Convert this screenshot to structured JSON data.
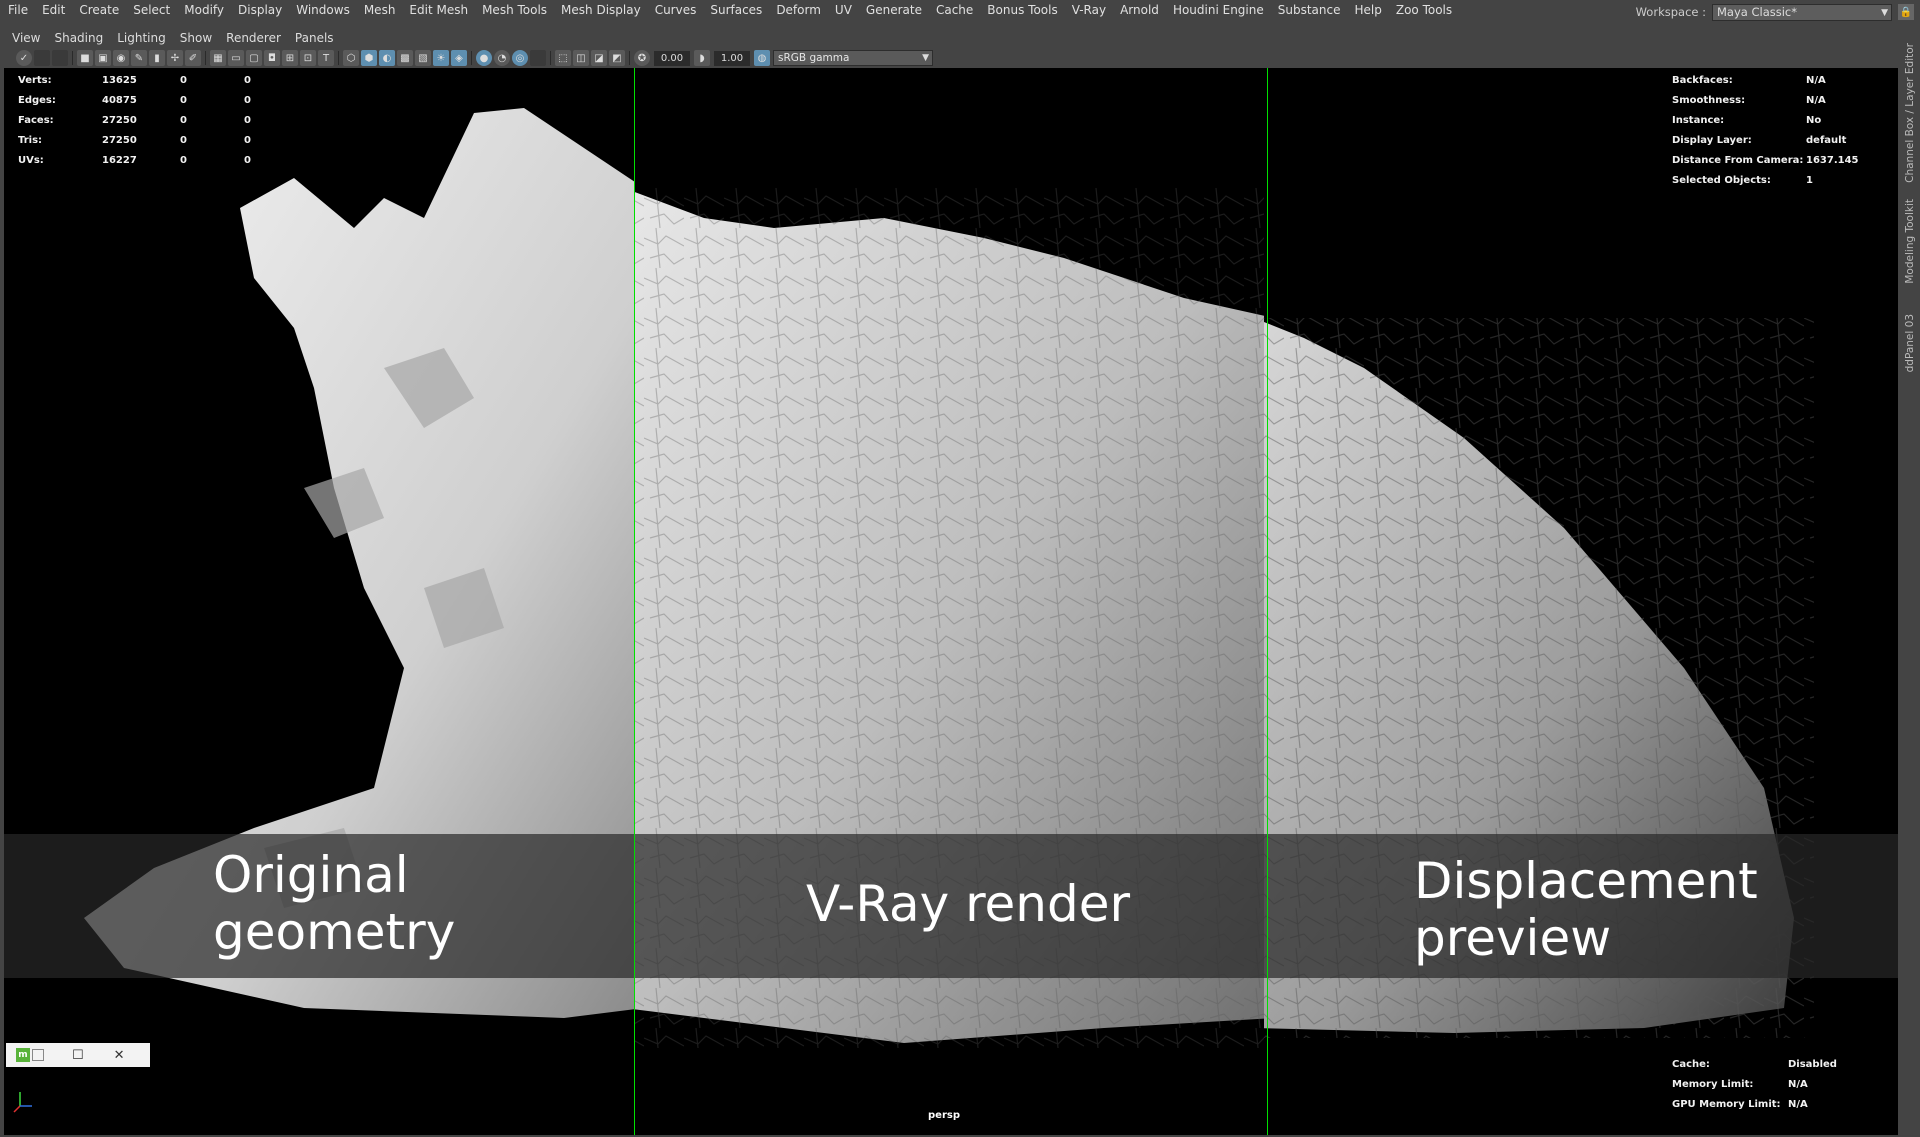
{
  "menubar": {
    "items": [
      "File",
      "Edit",
      "Create",
      "Select",
      "Modify",
      "Display",
      "Windows",
      "Mesh",
      "Edit Mesh",
      "Mesh Tools",
      "Mesh Display",
      "Curves",
      "Surfaces",
      "Deform",
      "UV",
      "Generate",
      "Cache",
      "Bonus Tools",
      "V-Ray",
      "Arnold",
      "Houdini Engine",
      "Substance",
      "Help",
      "Zoo Tools"
    ]
  },
  "workspace": {
    "label": "Workspace :",
    "value": "Maya Classic*"
  },
  "panel_menu": {
    "items": [
      "View",
      "Shading",
      "Lighting",
      "Show",
      "Renderer",
      "Panels"
    ]
  },
  "toolbar": {
    "exposure": "0.00",
    "gamma": "1.00",
    "color_space": "sRGB gamma"
  },
  "hud_left": {
    "rows": [
      {
        "label": "Verts:",
        "v1": "13625",
        "v2": "0",
        "v3": "0"
      },
      {
        "label": "Edges:",
        "v1": "40875",
        "v2": "0",
        "v3": "0"
      },
      {
        "label": "Faces:",
        "v1": "27250",
        "v2": "0",
        "v3": "0"
      },
      {
        "label": "Tris:",
        "v1": "27250",
        "v2": "0",
        "v3": "0"
      },
      {
        "label": "UVs:",
        "v1": "16227",
        "v2": "0",
        "v3": "0"
      }
    ]
  },
  "hud_right": {
    "rows": [
      {
        "label": "Backfaces:",
        "value": "N/A"
      },
      {
        "label": "Smoothness:",
        "value": "N/A"
      },
      {
        "label": "Instance:",
        "value": "No"
      },
      {
        "label": "Display Layer:",
        "value": "default"
      },
      {
        "label": "Distance From Camera:",
        "value": "1637.145"
      },
      {
        "label": "Selected Objects:",
        "value": "1"
      }
    ]
  },
  "hud_bottom": {
    "rows": [
      {
        "label": "Cache:",
        "value": "Disabled"
      },
      {
        "label": "Memory Limit:",
        "value": "N/A"
      },
      {
        "label": "GPU Memory Limit:",
        "value": "N/A"
      }
    ]
  },
  "captions": {
    "left_line1": "Original",
    "left_line2": "geometry",
    "middle": "V-Ray render",
    "right_line1": "Displacement",
    "right_line2": "preview"
  },
  "camera_label": "persp",
  "side_tabs": [
    "Channel Box / Layer Editor",
    "Modeling Toolkit",
    "ddPanel 03"
  ],
  "colors": {
    "divider": "#00e000",
    "viewport_bg": "#000000",
    "ui_bg": "#444444"
  }
}
